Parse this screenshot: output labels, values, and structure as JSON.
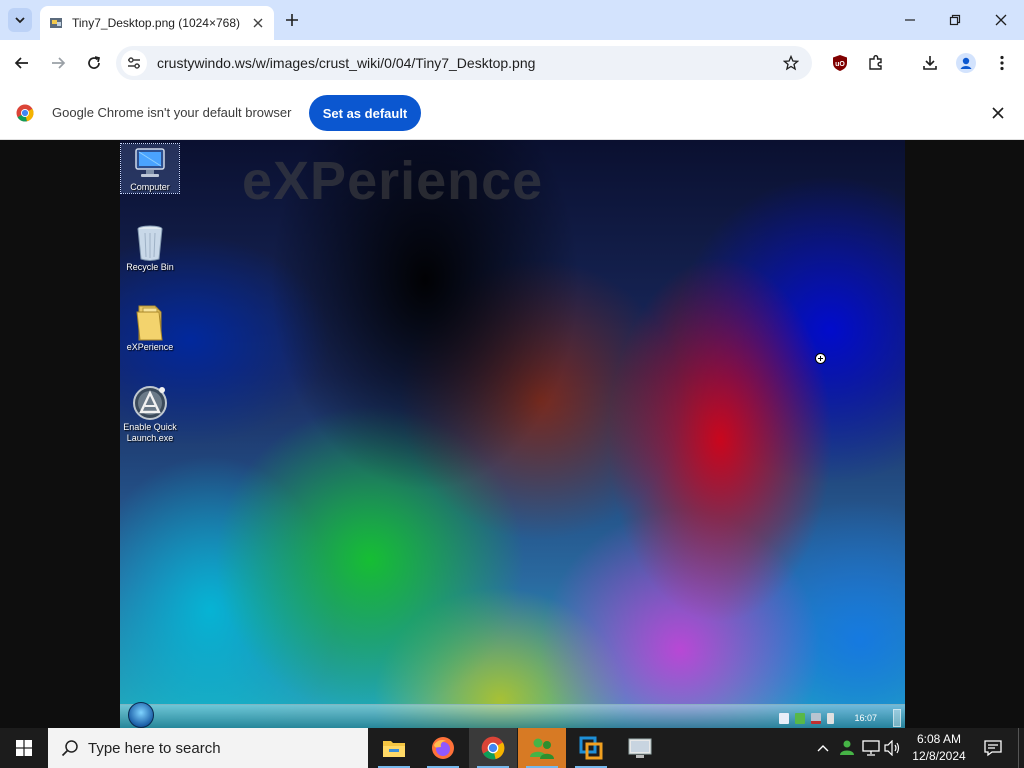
{
  "browser": {
    "tab": {
      "title": "Tiny7_Desktop.png (1024×768)"
    },
    "address": {
      "url": "crustywindo.ws/w/images/crust_wiki/0/04/Tiny7_Desktop.png"
    },
    "infobar": {
      "message": "Google Chrome isn't your default browser",
      "button_label": "Set as default"
    },
    "colors": {
      "tab_strip": "#d3e3fd",
      "accent": "#0b57d0"
    }
  },
  "desktop": {
    "brand_text": "eXPerience",
    "icons": [
      {
        "label": "Computer",
        "icon": "computer-icon"
      },
      {
        "label": "Recycle Bin",
        "icon": "recycle-bin-icon"
      },
      {
        "label": "eXPerience",
        "icon": "folder-icon"
      },
      {
        "label": "Enable Quick Launch.exe",
        "icon": "quick-launch-icon"
      }
    ],
    "clock": "16:07"
  },
  "taskbar": {
    "search_placeholder": "Type here to search",
    "apps": [
      "file-explorer-icon",
      "firefox-icon",
      "chrome-icon",
      "people-app-icon",
      "virtualbox-icon",
      "remote-desktop-icon"
    ],
    "clock_time": "6:08 AM",
    "clock_date": "12/8/2024"
  }
}
